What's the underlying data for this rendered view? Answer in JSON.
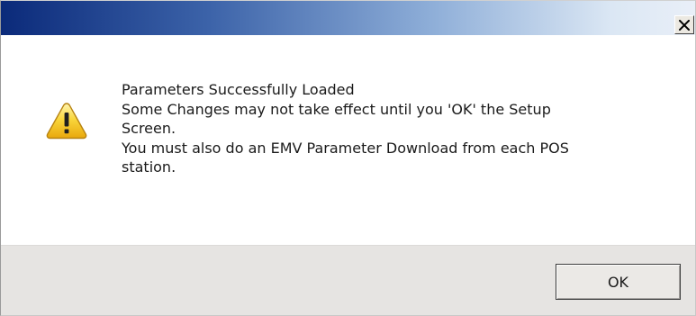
{
  "window": {
    "title": "",
    "close_label": "X"
  },
  "message": {
    "icon": "warning-icon",
    "lines": [
      "Parameters Successfully Loaded",
      "Some Changes may not take effect until you 'OK' the Setup",
      "Screen.",
      "You must also do an EMV Parameter Download from each POS",
      "station."
    ]
  },
  "buttons": {
    "ok_label": "OK"
  },
  "colors": {
    "titlebar_start": "#0b2a7a",
    "titlebar_end": "#e9eff8",
    "footer_bg": "#e6e4e2",
    "warning_fill": "#f5c61e"
  }
}
